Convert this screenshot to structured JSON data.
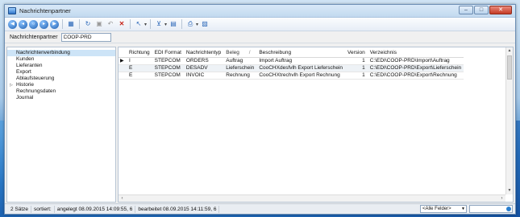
{
  "window": {
    "title": "Nachrichtenpartner"
  },
  "toolbar": {
    "buttons": [
      {
        "icon": "first-record-icon",
        "glyph": "◀"
      },
      {
        "icon": "previous-record-icon",
        "glyph": "◂"
      },
      {
        "icon": "stop-icon",
        "glyph": "○"
      },
      {
        "icon": "next-record-icon",
        "glyph": "▸"
      },
      {
        "icon": "last-record-icon",
        "glyph": "▶"
      }
    ]
  },
  "partner": {
    "label": "Nachrichtenpartner",
    "value": "COOP-PRD"
  },
  "sidebar": {
    "items": [
      {
        "label": "Nachrichtenverbindung",
        "selected": true
      },
      {
        "label": "Kunden"
      },
      {
        "label": "Lieferanten"
      },
      {
        "label": "Export"
      },
      {
        "label": "Ablaufsteuerung"
      },
      {
        "label": "Historie",
        "expandable": true
      },
      {
        "label": "Rechnungsdaten"
      },
      {
        "label": "Journal"
      }
    ]
  },
  "grid": {
    "columns": [
      "Richtung",
      "EDI Format",
      "Nachrichtentyp",
      "Beleg",
      "Beschreibung",
      "Version",
      "Verzeichnis"
    ],
    "rows": [
      [
        "I",
        "STEPCOM",
        "ORDERS",
        "Auftrag",
        "Import Auftrag",
        "1",
        "C:\\EDI\\COOP-PRD\\Import\\Auftrag"
      ],
      [
        "E",
        "STEPCOM",
        "DESADV",
        "Lieferschein",
        "CooCHXdesfvlh Export Lieferschein",
        "1",
        "C:\\EDI\\COOP-PRD\\Export\\Lieferschein"
      ],
      [
        "E",
        "STEPCOM",
        "INVOIC",
        "Rechnung",
        "CooCHXtrechvlh Export Rechnung",
        "1",
        "C:\\EDI\\COOP-PRD\\Export\\Rechnung"
      ]
    ]
  },
  "status": {
    "count": "2 Sätze",
    "sort": "sortiert:",
    "created": "angelegt 08.09.2015 14:09:55,  6",
    "edited": "bearbeitet 08.09.2015 14:11:59,  6",
    "fields_select": "<Alle Felder>"
  }
}
